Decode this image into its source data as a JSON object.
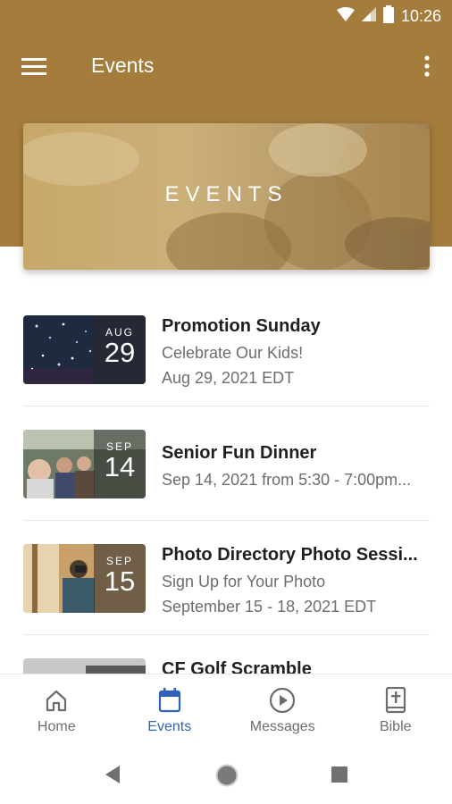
{
  "status_bar": {
    "time": "10:26"
  },
  "app_bar": {
    "title": "Events"
  },
  "banner": {
    "title": "EVENTS"
  },
  "events": [
    {
      "month": "AUG",
      "day": "29",
      "title": "Promotion Sunday",
      "subtitle": "Celebrate Our Kids!",
      "date": "Aug 29, 2021 EDT"
    },
    {
      "month": "SEP",
      "day": "14",
      "title": "Senior Fun Dinner",
      "date": "Sep 14, 2021 from 5:30 - 7:00pm..."
    },
    {
      "month": "SEP",
      "day": "15",
      "title": "Photo Directory Photo Sessi...",
      "subtitle": "Sign Up for Your Photo",
      "date": "September 15 - 18, 2021 EDT"
    },
    {
      "title": "CF Golf Scramble"
    }
  ],
  "bottom_nav": {
    "items": [
      {
        "label": "Home",
        "icon": "home-icon"
      },
      {
        "label": "Events",
        "icon": "calendar-icon",
        "active": true
      },
      {
        "label": "Messages",
        "icon": "play-circle-icon"
      },
      {
        "label": "Bible",
        "icon": "bible-icon"
      }
    ]
  },
  "colors": {
    "header": "#a47c3c",
    "active": "#2f62b8",
    "text_secondary": "#6d6d6d"
  }
}
